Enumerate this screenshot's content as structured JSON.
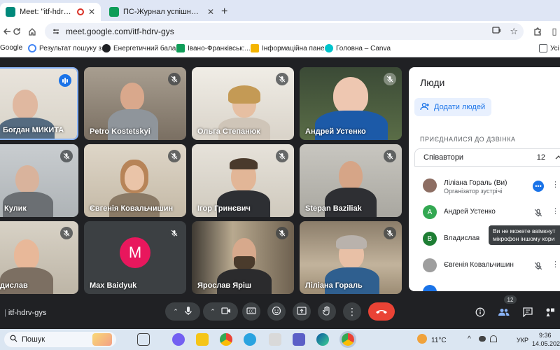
{
  "browser": {
    "tabs": [
      {
        "title": "Meet: \"itf-hdrv-gys\"",
        "active": true
      },
      {
        "title": "ПС-Журнал успішності WEB >",
        "active": false
      }
    ],
    "url": "meet.google.com/itf-hdrv-gys",
    "bookmarks": [
      {
        "label": "Google",
        "color": "#4285f4"
      },
      {
        "label": "Результат пошуку з...",
        "color": "#34a853"
      },
      {
        "label": "Енергетичний бала...",
        "color": "#202124"
      },
      {
        "label": "Івано-Франківськ:...",
        "color": "#0f9d58"
      },
      {
        "label": "Інформаційна пане...",
        "color": "#f4b400"
      },
      {
        "label": "Головна – Canva",
        "color": "#00c4cc"
      },
      {
        "label": "Усі",
        "color": "#5f6368"
      }
    ]
  },
  "tiles": [
    {
      "name": "Богдан МИКИТА",
      "state": "speaking"
    },
    {
      "name": "Petro Kostetskyi",
      "state": "muted"
    },
    {
      "name": "Ольга Степанюк",
      "state": "muted"
    },
    {
      "name": "Андрей Устенко",
      "state": "muted"
    },
    {
      "name": "Кулик",
      "state": "muted"
    },
    {
      "name": "Євгенія Ковальчишин",
      "state": "muted"
    },
    {
      "name": "Ігор Гринєвич",
      "state": "muted"
    },
    {
      "name": "Stepan Baziliak",
      "state": "muted"
    },
    {
      "name": "дислав",
      "state": "muted"
    },
    {
      "name": "Max Baidyuk",
      "state": "muted",
      "initial": "M"
    },
    {
      "name": "Ярослав Яріш",
      "state": "muted"
    },
    {
      "name": "Ліліана Гораль",
      "state": "muted"
    }
  ],
  "people_panel": {
    "title": "Люди",
    "add_button": "Додати людей",
    "section": "ПРИЄДНАЛИСЯ ДО ДЗВІНКА",
    "speakers_label": "Співавтори",
    "speakers_count": "12",
    "people": [
      {
        "name": "Ліліана Гораль (Ви)",
        "role": "Організатор зустрічі",
        "avatar_color": "#8d6e63",
        "initial": ""
      },
      {
        "name": "Андрей Устенко",
        "role": "",
        "avatar_color": "#33a852",
        "initial": "А"
      },
      {
        "name": "Владислав",
        "role": "",
        "avatar_color": "#1e7e34",
        "initial": "В"
      },
      {
        "name": "Євгенія Ковальчишин",
        "role": "",
        "avatar_color": "#9e9e9e",
        "initial": ""
      }
    ],
    "tooltip_line1": "Ви не можете ввімкнут",
    "tooltip_line2": "мікрофон іншому кори"
  },
  "controls": {
    "meeting_code": "itf-hdrv-gys",
    "people_badge": "12"
  },
  "taskbar": {
    "search": "Пошук",
    "weather": "11°C",
    "lang": "УКР",
    "time": "9:36",
    "date": "14.05.202"
  }
}
